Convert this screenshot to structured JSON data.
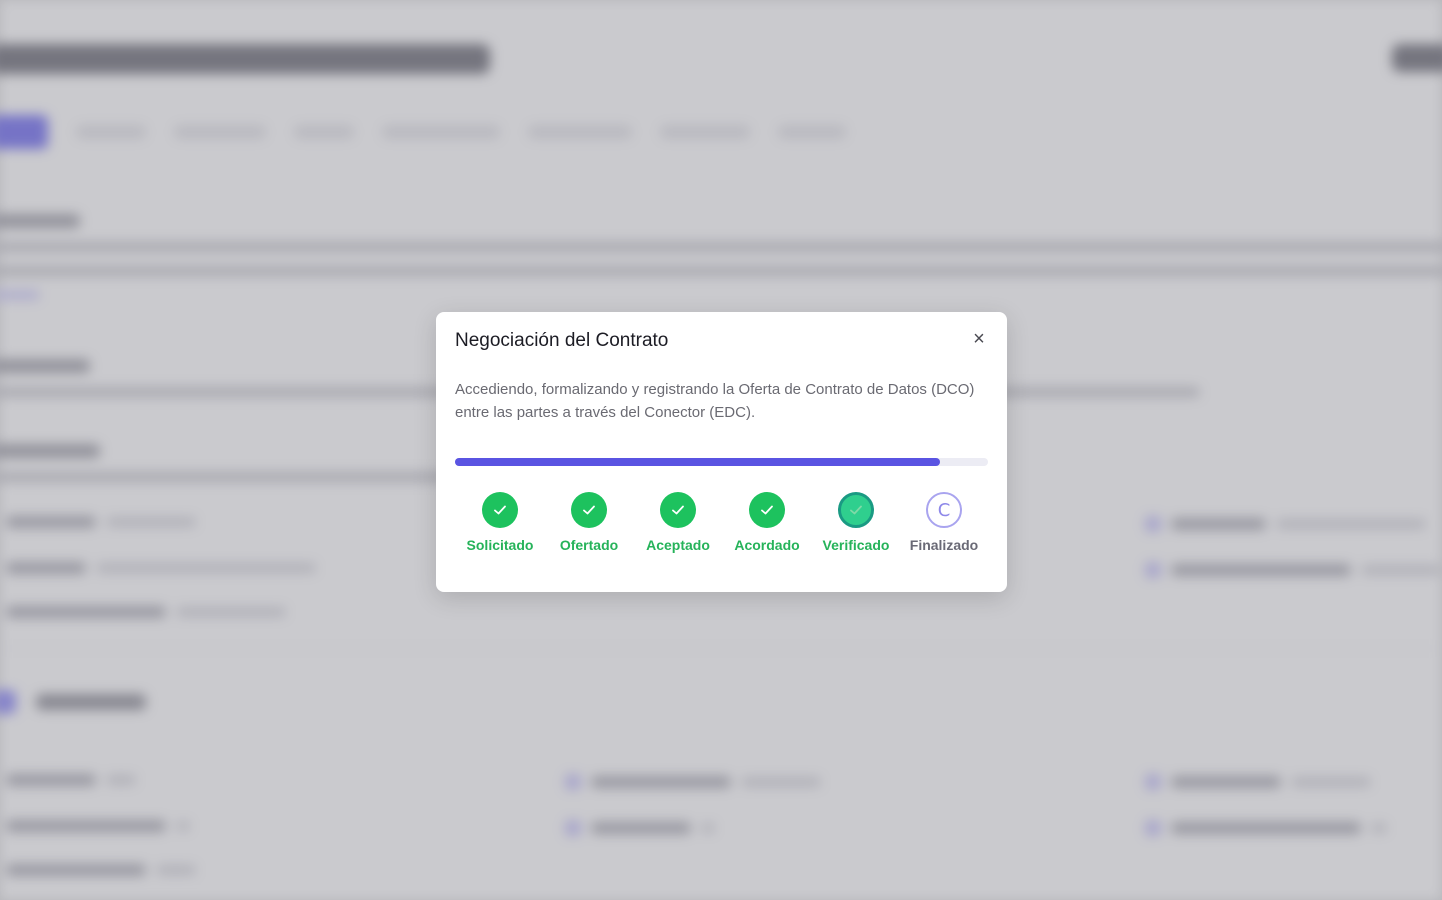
{
  "modal": {
    "title": "Negociación del Contrato",
    "close_symbol": "×",
    "description": "Accediendo, formalizando y registrando la Oferta de Contrato de Datos (DCO) entre las partes a través del Conector (EDC).",
    "progress_fraction": 0.91,
    "accent_color": "#5a54e2",
    "steps": [
      {
        "label": "Solicitado",
        "status": "done"
      },
      {
        "label": "Ofertado",
        "status": "done"
      },
      {
        "label": "Aceptado",
        "status": "done"
      },
      {
        "label": "Acordado",
        "status": "done"
      },
      {
        "label": "Verificado",
        "status": "active"
      },
      {
        "label": "Finalizado",
        "status": "pending",
        "icon_glyph": "C"
      }
    ],
    "success_color": "#1dc25e"
  }
}
